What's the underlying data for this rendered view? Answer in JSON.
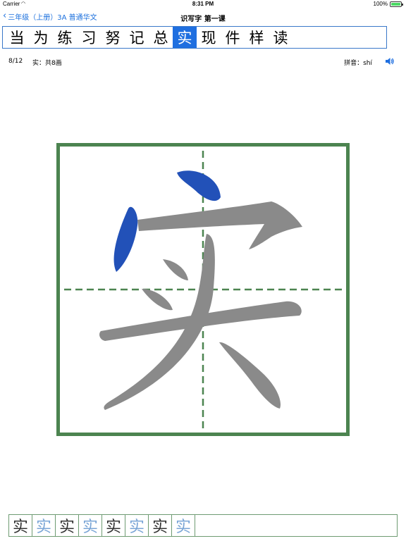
{
  "status_bar": {
    "carrier": "Carrier",
    "time": "8:31 PM",
    "battery": "100%",
    "battery_level": 1.0
  },
  "nav": {
    "back_label": "三年级（上册）3A 普通华文",
    "title": "识写字 第一课"
  },
  "characters": [
    "当",
    "为",
    "练",
    "习",
    "努",
    "记",
    "总",
    "实",
    "现",
    "件",
    "样",
    "读"
  ],
  "selected_index": 7,
  "info": {
    "index_text": "8/12",
    "strokes_text": "实：共8画",
    "pinyin_text": "拼音：shí"
  },
  "practice": {
    "cells": [
      "实",
      "实",
      "实",
      "实",
      "实",
      "实",
      "实",
      "实"
    ]
  },
  "colors": {
    "accent": "#1f6fe0",
    "grid_green": "#4c8450",
    "stroke_done": "#2251b8",
    "stroke_pending": "#8a8a8a"
  }
}
